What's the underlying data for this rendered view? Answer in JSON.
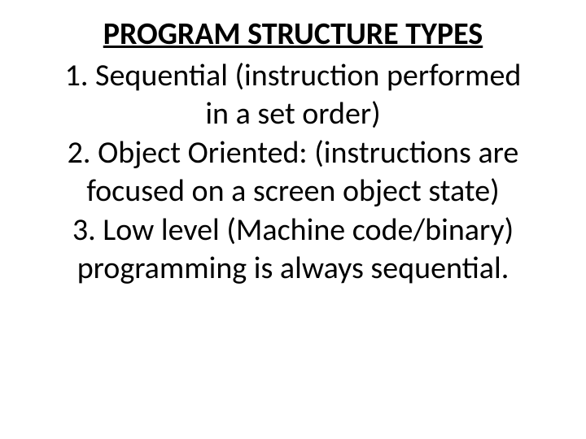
{
  "slide": {
    "title": "PROGRAM STRUCTURE TYPES",
    "lines": {
      "l1": "1.  Sequential (instruction performed",
      "l2": "in a set order)",
      "l3": "2.  Object Oriented:  (instructions are",
      "l4": "focused on a screen object state)",
      "l5": "3.  Low level (Machine code/binary)",
      "l6": "programming is always sequential."
    }
  }
}
